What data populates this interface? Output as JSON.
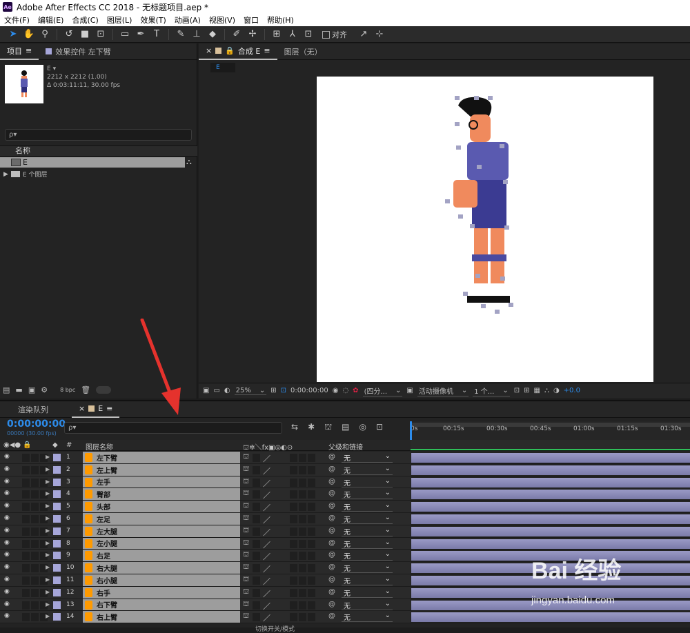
{
  "window": {
    "app_icon": "Ae",
    "title": "Adobe After Effects CC 2018 - 无标题项目.aep *"
  },
  "menu": [
    "文件(F)",
    "编辑(E)",
    "合成(C)",
    "图层(L)",
    "效果(T)",
    "动画(A)",
    "视图(V)",
    "窗口",
    "帮助(H)"
  ],
  "toolbar": {
    "snap_label": "对齐"
  },
  "project": {
    "tab_label": "项目",
    "effects_tab_label": "效果控件 左下臂",
    "item_name": "E",
    "item_dims": "2212 x 2212 (1.00)",
    "item_duration": "Δ 0:03:11:11, 30.00 fps",
    "search_placeholder": "ρ▾",
    "col_name": "名称",
    "items": [
      {
        "name": "E"
      },
      {
        "name": "E 个图层"
      }
    ],
    "bpc": "8 bpc"
  },
  "composition": {
    "tab_label": "合成 E",
    "layer_tab_label": "图层（无）",
    "breadcrumb": "E"
  },
  "viewer": {
    "zoom": "25%",
    "time": "0:00:00:00",
    "resolution": "(四分...",
    "camera": "活动摄像机",
    "views": "1 个...",
    "exposure": "+0.0"
  },
  "timeline": {
    "render_queue_tab": "渲染队列",
    "comp_tab": "E",
    "timecode": "0:00:00:00",
    "timecode_sub": "00000 (30.00 fps)",
    "search_placeholder": "ρ▾",
    "header_num": "#",
    "header_name": "图层名称",
    "header_parent": "父级和链接",
    "ruler": [
      "0s",
      "00:15s",
      "00:30s",
      "00:45s",
      "01:00s",
      "01:15s",
      "01:30s"
    ],
    "layers": [
      {
        "num": "1",
        "name": "左下臂",
        "parent": "无"
      },
      {
        "num": "2",
        "name": "左上臂",
        "parent": "无"
      },
      {
        "num": "3",
        "name": "左手",
        "parent": "无"
      },
      {
        "num": "4",
        "name": "臀部",
        "parent": "无"
      },
      {
        "num": "5",
        "name": "头部",
        "parent": "无"
      },
      {
        "num": "6",
        "name": "左足",
        "parent": "无"
      },
      {
        "num": "7",
        "name": "左大腿",
        "parent": "无"
      },
      {
        "num": "8",
        "name": "左小腿",
        "parent": "无"
      },
      {
        "num": "9",
        "name": "右足",
        "parent": "无"
      },
      {
        "num": "10",
        "name": "右大腿",
        "parent": "无"
      },
      {
        "num": "11",
        "name": "右小腿",
        "parent": "无"
      },
      {
        "num": "12",
        "name": "右手",
        "parent": "无"
      },
      {
        "num": "13",
        "name": "右下臂",
        "parent": "无"
      },
      {
        "num": "14",
        "name": "右上臂",
        "parent": "无"
      }
    ],
    "footer": "切换开关/模式"
  },
  "watermark": {
    "brand": "Bai 经验",
    "url": "jingyan.baidu.com"
  },
  "colors": {
    "accent": "#2d8ceb",
    "layer_label": "#a6a6d9",
    "layer_bar": "#8c8cb8",
    "layer_icon": "#ff9a00"
  }
}
